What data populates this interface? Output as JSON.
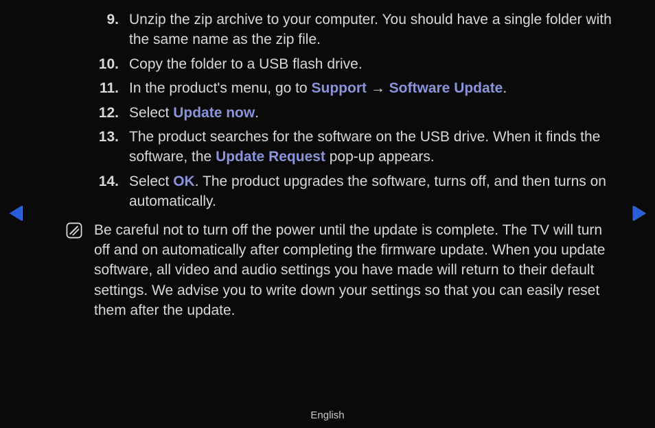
{
  "steps": [
    {
      "num": "9.",
      "parts": [
        {
          "t": "Unzip the zip archive to your computer. You should have a single folder with the same name as the zip file.",
          "hl": false
        }
      ]
    },
    {
      "num": "10.",
      "parts": [
        {
          "t": "Copy the folder to a USB flash drive.",
          "hl": false
        }
      ]
    },
    {
      "num": "11.",
      "parts": [
        {
          "t": "In the product's menu, go to ",
          "hl": false
        },
        {
          "t": "Support",
          "hl": true
        },
        {
          "t": " → ",
          "hl": false
        },
        {
          "t": "Software Update",
          "hl": true
        },
        {
          "t": ".",
          "hl": false
        }
      ]
    },
    {
      "num": "12.",
      "parts": [
        {
          "t": "Select ",
          "hl": false
        },
        {
          "t": "Update now",
          "hl": true
        },
        {
          "t": ".",
          "hl": false
        }
      ]
    },
    {
      "num": "13.",
      "parts": [
        {
          "t": "The product searches for the software on the USB drive. When it finds the software, the ",
          "hl": false
        },
        {
          "t": "Update Request",
          "hl": true
        },
        {
          "t": " pop-up appears.",
          "hl": false
        }
      ]
    },
    {
      "num": "14.",
      "parts": [
        {
          "t": "Select ",
          "hl": false
        },
        {
          "t": "OK",
          "hl": true
        },
        {
          "t": ". The product upgrades the software, turns off, and then turns on automatically.",
          "hl": false
        }
      ]
    }
  ],
  "note": "Be careful not to turn off the power until the update is complete. The TV will turn off and on automatically after completing the firmware update. When you update software, all video and audio settings you have made will return to their default settings. We advise you to write down your settings so that you can easily reset them after the update.",
  "footer": "English"
}
